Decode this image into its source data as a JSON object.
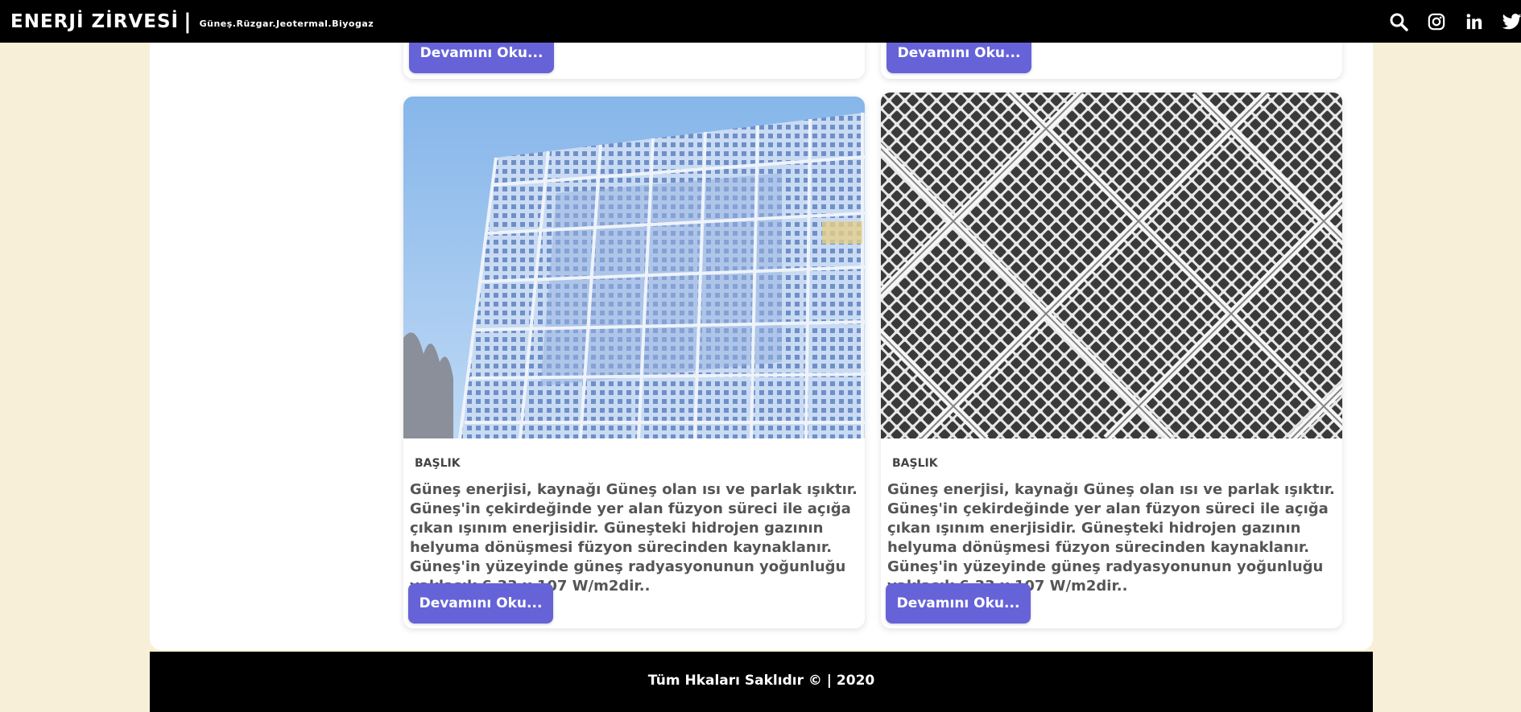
{
  "header": {
    "brand_title": "ENERJİ ZİRVESİ",
    "separator": "|",
    "tagline": "Güneş.Rüzgar.Jeotermal.Biyogaz",
    "icons": [
      "search-icon",
      "instagram-icon",
      "linkedin-icon",
      "twitter-icon"
    ]
  },
  "top_cards": [
    {
      "button_label": "Devamını Oku..."
    },
    {
      "button_label": "Devamını Oku..."
    }
  ],
  "cards": [
    {
      "image": "glass-building-facade-photo",
      "title": "BAŞLIK",
      "text": "Güneş enerjisi, kaynağı Güneş olan ısı ve parlak ışıktır. Güneş'in çekirdeğinde yer alan füzyon süreci ile açığa çıkan ışınım enerjisidir. Güneşteki hidrojen gazının helyuma dönüşmesi füzyon sürecinden kaynaklanır. Güneş'in yüzeyinde güneş radyasyonunun yoğunluğu yaklaşık 6,33 x 107 W/m2dir..",
      "button_label": "Devamını Oku..."
    },
    {
      "image": "solar-panel-grid-photo",
      "title": "BAŞLIK",
      "text": "Güneş enerjisi, kaynağı Güneş olan ısı ve parlak ışıktır. Güneş'in çekirdeğinde yer alan füzyon süreci ile açığa çıkan ışınım enerjisidir. Güneşteki hidrojen gazının helyuma dönüşmesi füzyon sürecinden kaynaklanır. Güneş'in yüzeyinde güneş radyasyonunun yoğunluğu yaklaşık 6,33 x 107 W/m2dir..",
      "button_label": "Devamını Oku..."
    }
  ],
  "footer": {
    "text": "Tüm Hkaları Saklıdır © | 2020"
  },
  "colors": {
    "accent": "#6663d8",
    "page_bg": "#f7efd7",
    "bar_bg": "#000000"
  }
}
